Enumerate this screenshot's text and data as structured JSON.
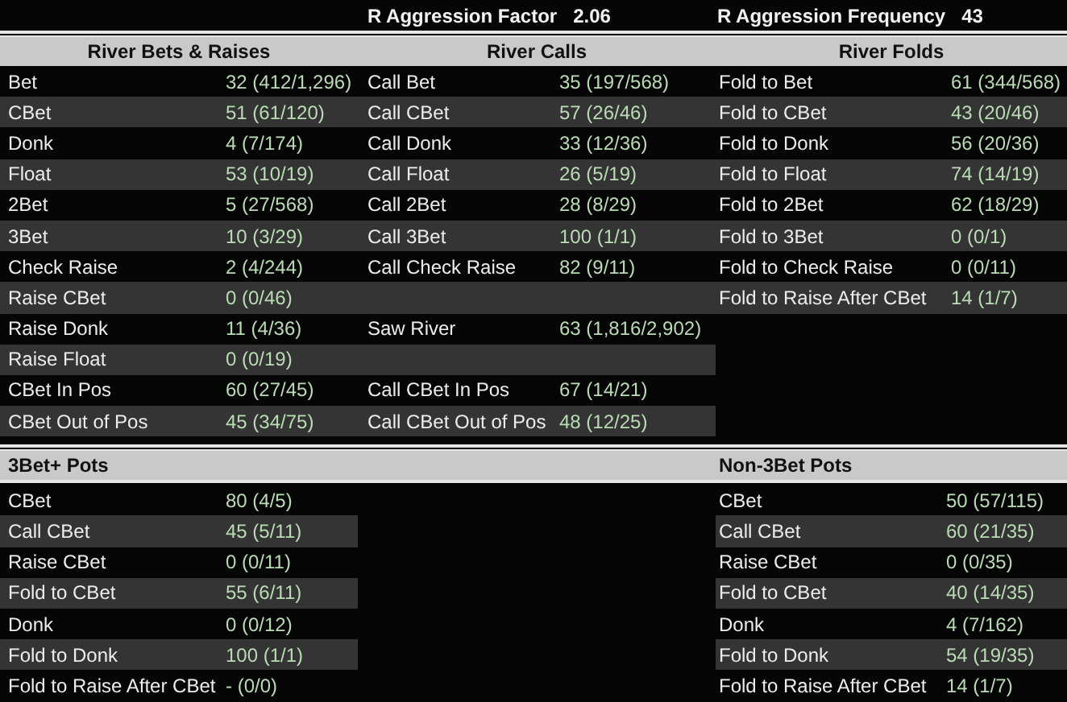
{
  "summary": [
    {
      "label": "R Aggression Factor",
      "value": "2.06"
    },
    {
      "label": "R Aggression Frequency",
      "value": "43"
    }
  ],
  "river": [
    {
      "title": "River Bets & Raises",
      "rows": [
        {
          "label": "Bet",
          "value": "32 (412/1,296)"
        },
        {
          "label": "CBet",
          "value": "51 (61/120)"
        },
        {
          "label": "Donk",
          "value": "4 (7/174)"
        },
        {
          "label": "Float",
          "value": "53 (10/19)"
        },
        {
          "label": "2Bet",
          "value": "5 (27/568)"
        },
        {
          "label": "3Bet",
          "value": "10 (3/29)"
        },
        {
          "label": "Check Raise",
          "value": "2 (4/244)"
        },
        {
          "label": "Raise CBet",
          "value": "0 (0/46)"
        },
        {
          "label": "Raise Donk",
          "value": "11 (4/36)"
        },
        {
          "label": "Raise Float",
          "value": "0 (0/19)"
        },
        {
          "label": "CBet In Pos",
          "value": "60 (27/45)"
        },
        {
          "label": "CBet Out of Pos",
          "value": "45 (34/75)"
        }
      ]
    },
    {
      "title": "River Calls",
      "rows": [
        {
          "label": "Call Bet",
          "value": "35 (197/568)"
        },
        {
          "label": "Call CBet",
          "value": "57 (26/46)"
        },
        {
          "label": "Call Donk",
          "value": "33 (12/36)"
        },
        {
          "label": "Call Float",
          "value": "26 (5/19)"
        },
        {
          "label": "Call 2Bet",
          "value": "28 (8/29)"
        },
        {
          "label": "Call 3Bet",
          "value": "100 (1/1)"
        },
        {
          "label": "Call Check Raise",
          "value": "82 (9/11)"
        },
        null,
        {
          "label": "Saw River",
          "value": "63 (1,816/2,902)"
        },
        null,
        {
          "label": "Call CBet In Pos",
          "value": "67 (14/21)"
        },
        {
          "label": "Call CBet Out of Pos",
          "value": "48 (12/25)"
        }
      ]
    },
    {
      "title": "River Folds",
      "rows": [
        {
          "label": "Fold to Bet",
          "value": "61 (344/568)"
        },
        {
          "label": "Fold to CBet",
          "value": "43 (20/46)"
        },
        {
          "label": "Fold to Donk",
          "value": "56 (20/36)"
        },
        {
          "label": "Fold to Float",
          "value": "74 (14/19)"
        },
        {
          "label": "Fold to 2Bet",
          "value": "62 (18/29)"
        },
        {
          "label": "Fold to 3Bet",
          "value": "0 (0/1)"
        },
        {
          "label": "Fold to Check Raise",
          "value": "0 (0/11)"
        },
        {
          "label": "Fold to Raise After CBet",
          "value": "14 (1/7)"
        }
      ]
    }
  ],
  "pots": [
    {
      "title": "3Bet+ Pots",
      "rows": [
        {
          "label": "CBet",
          "value": "80 (4/5)"
        },
        {
          "label": "Call CBet",
          "value": "45 (5/11)"
        },
        {
          "label": "Raise CBet",
          "value": "0 (0/11)"
        },
        {
          "label": "Fold to CBet",
          "value": "55 (6/11)"
        },
        {
          "label": "Donk",
          "value": "0 (0/12)"
        },
        {
          "label": "Fold to Donk",
          "value": "100 (1/1)"
        },
        {
          "label": "Fold to Raise After CBet",
          "value": "- (0/0)"
        }
      ]
    },
    {
      "title": "Non-3Bet Pots",
      "rows": [
        {
          "label": "CBet",
          "value": "50 (57/115)"
        },
        {
          "label": "Call CBet",
          "value": "60 (21/35)"
        },
        {
          "label": "Raise CBet",
          "value": "0 (0/35)"
        },
        {
          "label": "Fold to CBet",
          "value": "40 (14/35)"
        },
        {
          "label": "Donk",
          "value": "4 (7/162)"
        },
        {
          "label": "Fold to Donk",
          "value": "54 (19/35)"
        },
        {
          "label": "Fold to Raise After CBet",
          "value": "14 (1/7)"
        }
      ]
    }
  ]
}
